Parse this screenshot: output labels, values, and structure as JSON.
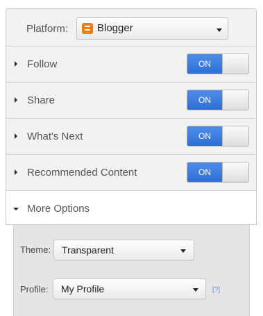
{
  "platform": {
    "label": "Platform:",
    "selected": "Blogger",
    "icon": "blogger-icon",
    "icon_color": "#f57d00"
  },
  "sections": [
    {
      "label": "Follow",
      "toggle": "ON"
    },
    {
      "label": "Share",
      "toggle": "ON"
    },
    {
      "label": "What's Next",
      "toggle": "ON"
    },
    {
      "label": "Recommended Content",
      "toggle": "ON"
    }
  ],
  "more_options": {
    "label": "More Options",
    "expanded": true
  },
  "options": {
    "theme": {
      "label": "Theme:",
      "selected": "Transparent"
    },
    "profile": {
      "label": "Profile:",
      "selected": "My Profile",
      "help": "[?]"
    }
  },
  "colors": {
    "toggle_on": "#2d6fd6",
    "panel_bg": "#f2f2f2",
    "options_bg": "#e5e5e5"
  }
}
